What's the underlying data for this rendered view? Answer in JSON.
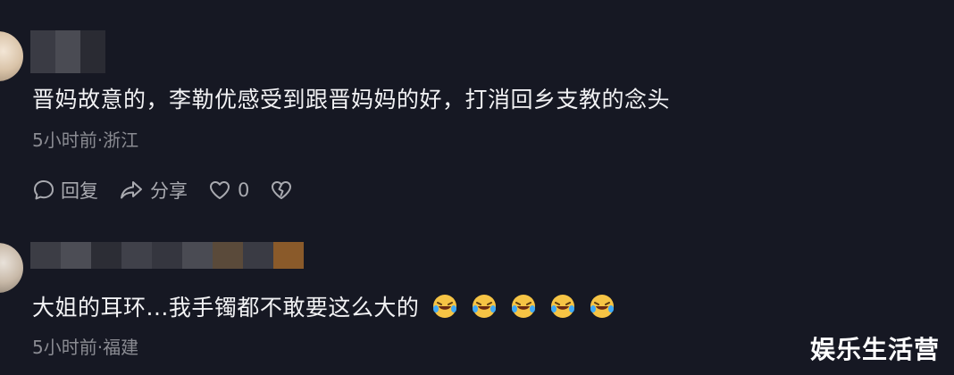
{
  "comments": [
    {
      "text": "晋妈故意的，李勒优感受到跟晋妈妈的好，打消回乡支教的念头",
      "meta": "5小时前·浙江",
      "actions": {
        "reply_label": "回复",
        "share_label": "分享",
        "like_count": "0"
      }
    },
    {
      "text": "大姐的耳环...我手镯都不敢要这么大的",
      "emoji_icons": [
        "rofl-emoji",
        "rofl-emoji",
        "rofl-emoji",
        "rofl-emoji",
        "rofl-emoji"
      ],
      "meta": "5小时前·福建"
    }
  ],
  "watermark": "娱乐生活营",
  "colors": {
    "background": "#161823",
    "text": "#f2f2f4",
    "meta": "#8a8b92",
    "action": "#a9aab0"
  }
}
